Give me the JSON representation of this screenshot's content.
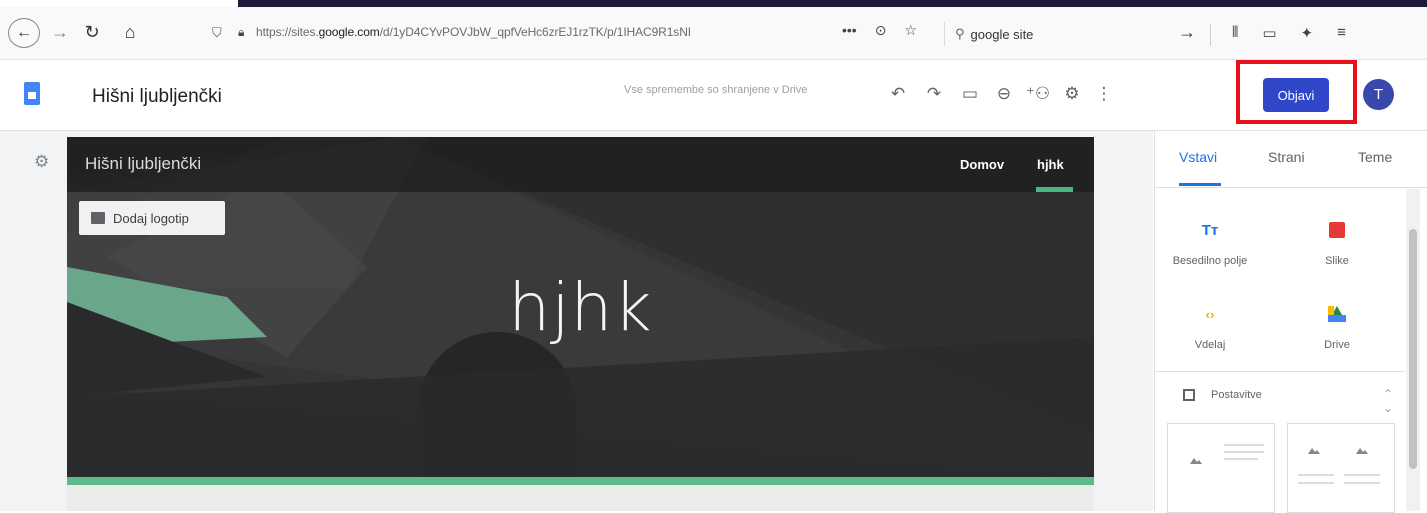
{
  "browser": {
    "url_prefix": "https://sites.",
    "url_domain": "google.com",
    "url_rest": "/d/1yD4CYvPOVJbW_qpfVeHc6zrEJ1rzTK/p/1IHAC9R1sNI",
    "url_actions": [
      "•••",
      "⊙",
      "☆"
    ],
    "search_value": "google site",
    "search_go": "→"
  },
  "app": {
    "title": "Hišni ljubljenčki",
    "save_status": "Vse spremembe so shranjene v Drive",
    "publish_label": "Objavi",
    "avatar_letter": "T"
  },
  "site": {
    "name": "Hišni ljubljenčki",
    "nav": [
      "Domov",
      "hjhk"
    ],
    "add_logo_label": "Dodaj logotip",
    "hero_title": "hjhk"
  },
  "panel": {
    "tabs": [
      "Vstavi",
      "Strani",
      "Teme"
    ],
    "insert": {
      "textbox_label": "Besedilno polje",
      "images_label": "Slike",
      "embed_label": "Vdelaj",
      "drive_label": "Drive",
      "textbox_icon": "Tт",
      "embed_icon": "‹›"
    },
    "layouts_label": "Postavitve"
  },
  "colors": {
    "publish_button": "#3046c8",
    "highlight_box": "#e8101b",
    "active_tab": "#1a73e8",
    "hero_strip": "#5dbb8a"
  }
}
